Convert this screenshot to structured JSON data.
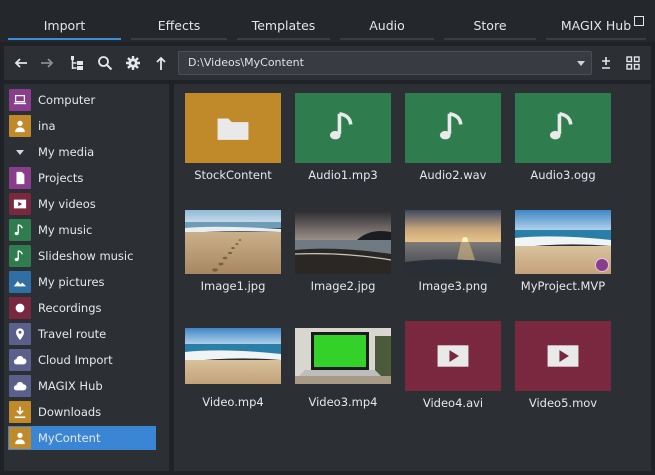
{
  "tabs": [
    {
      "label": "Import",
      "active": true
    },
    {
      "label": "Effects",
      "active": false
    },
    {
      "label": "Templates",
      "active": false
    },
    {
      "label": "Audio",
      "active": false
    },
    {
      "label": "Store",
      "active": false
    },
    {
      "label": "MAGIX Hub",
      "active": false
    }
  ],
  "toolbar": {
    "path": "D:\\Videos\\MyContent",
    "icons": [
      "back-arrow-icon",
      "forward-arrow-icon",
      "folder-tree-icon",
      "search-icon",
      "gear-icon",
      "up-arrow-icon",
      "add-remove-icon",
      "grid-view-icon"
    ]
  },
  "sidebar": {
    "items": [
      {
        "label": "Computer",
        "icon": "laptop-icon",
        "color": "#8a3c8d"
      },
      {
        "label": "ina",
        "icon": "user-icon",
        "color": "#c08a2b"
      },
      {
        "label": "My media",
        "icon": "chevron-down-icon",
        "color": ""
      },
      {
        "label": "Projects",
        "icon": "document-icon",
        "color": "#8a3c8d"
      },
      {
        "label": "My videos",
        "icon": "play-icon",
        "color": "#7a2740"
      },
      {
        "label": "My music",
        "icon": "music-note-icon",
        "color": "#2f7d4f"
      },
      {
        "label": "Slideshow music",
        "icon": "music-note-icon",
        "color": "#2f7d4f"
      },
      {
        "label": "My pictures",
        "icon": "mountain-icon",
        "color": "#2f6fa3"
      },
      {
        "label": "Recordings",
        "icon": "record-icon",
        "color": "#7a2740"
      },
      {
        "label": "Travel route",
        "icon": "map-pin-icon",
        "color": "#5a5f8c"
      },
      {
        "label": "Cloud Import",
        "icon": "cloud-icon",
        "color": "#5a5f8c"
      },
      {
        "label": "MAGIX Hub",
        "icon": "cloud-icon",
        "color": "#5a5f8c"
      },
      {
        "label": "Downloads",
        "icon": "download-icon",
        "color": "#c08a2b"
      },
      {
        "label": "MyContent",
        "icon": "user-icon",
        "color": "#c08a2b",
        "selected": true
      }
    ]
  },
  "files": [
    {
      "label": "StockContent",
      "kind": "folder"
    },
    {
      "label": "Audio1.mp3",
      "kind": "audio"
    },
    {
      "label": "Audio2.wav",
      "kind": "audio"
    },
    {
      "label": "Audio3.ogg",
      "kind": "audio"
    },
    {
      "label": "Image1.jpg",
      "kind": "image",
      "scene": "beach-footprints"
    },
    {
      "label": "Image2.jpg",
      "kind": "image",
      "scene": "dusk-coast"
    },
    {
      "label": "Image3.png",
      "kind": "image",
      "scene": "sunset-sea"
    },
    {
      "label": "MyProject.MVP",
      "kind": "project",
      "scene": "beach-waves"
    },
    {
      "label": "Video.mp4",
      "kind": "image",
      "scene": "beach-waves"
    },
    {
      "label": "Video3.mp4",
      "kind": "image",
      "scene": "laptop-greenscreen"
    },
    {
      "label": "Video4.avi",
      "kind": "video"
    },
    {
      "label": "Video5.mov",
      "kind": "video"
    }
  ]
}
